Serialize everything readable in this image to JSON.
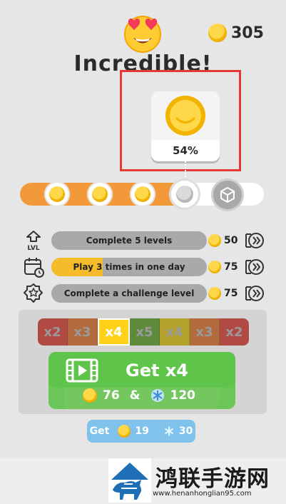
{
  "header": {
    "coins": "305",
    "title": "Incredible!",
    "emoji_icon": "heart-eyes-emoji-icon"
  },
  "reward_card": {
    "percent": "54%",
    "icon": "gold-coin-icon",
    "highlight_color": "#e53935"
  },
  "progress": {
    "fill_fraction": 0.67,
    "fill_color": "#f29a3a",
    "nodes": [
      "coin",
      "coin",
      "coin",
      "coin-locked",
      "box-locked"
    ]
  },
  "missions": [
    {
      "icon": "level-up-icon",
      "icon_text": "LVL",
      "label": "Complete 5 levels",
      "reward": "50",
      "progress": 0
    },
    {
      "icon": "calendar-icon",
      "label": "Play 3 times in one day",
      "reward": "75",
      "progress": 0.33
    },
    {
      "icon": "star-badge-icon",
      "label": "Complete a challenge level",
      "reward": "75",
      "progress": 0
    }
  ],
  "multiplier": {
    "cells": [
      {
        "label": "x2",
        "color": "#b24a44"
      },
      {
        "label": "x3",
        "color": "#b36b3e"
      },
      {
        "label": "x4",
        "color": "#ffd21a",
        "active": true
      },
      {
        "label": "x5",
        "color": "#5e8a3c"
      },
      {
        "label": "x4",
        "color": "#b4a42e"
      },
      {
        "label": "x3",
        "color": "#b36b3e"
      },
      {
        "label": "x2",
        "color": "#b24a44"
      }
    ]
  },
  "get_button": {
    "label": "Get x4",
    "coins": "76",
    "amp": "&",
    "gems": "120",
    "color": "#6cc558"
  },
  "small_get": {
    "label": "Get",
    "coins": "19",
    "gems": "30",
    "color": "#7fc3ec"
  },
  "watermark": {
    "brand": "鸿联手游网",
    "url": "www.henanhonglian95.com"
  }
}
